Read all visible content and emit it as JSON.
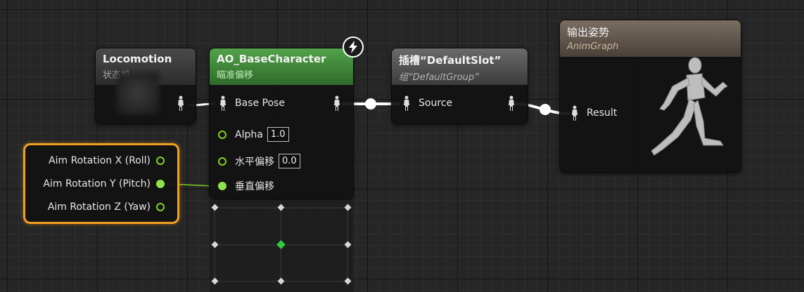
{
  "colors": {
    "background": "#262626",
    "pose_header": "#5c5c5c",
    "blend_header": "#3f8f3a",
    "accent_green": "#7ed321",
    "selection_orange": "#f0a020"
  },
  "nodes": {
    "locomotion": {
      "title": "Locomotion",
      "subtitle": "状态机"
    },
    "aim_offset": {
      "title": "AO_BaseCharacter",
      "subtitle": "瞄准偏移",
      "base_pose_label": "Base Pose",
      "alpha_label": "Alpha",
      "alpha_value": "1.0",
      "horizontal_label": "水平偏移",
      "horizontal_value": "0.0",
      "vertical_label": "垂直偏移",
      "badge_icon": "lightning-icon"
    },
    "slot": {
      "title": "插槽“DefaultSlot”",
      "subtitle": "组“DefaultGroup”",
      "source_label": "Source"
    },
    "output": {
      "title": "输出姿势",
      "subtitle": "AnimGraph",
      "result_label": "Result"
    },
    "break_rotator": {
      "pins": [
        "Aim Rotation X (Roll)",
        "Aim Rotation Y (Pitch)",
        "Aim Rotation Z (Yaw)"
      ]
    }
  }
}
